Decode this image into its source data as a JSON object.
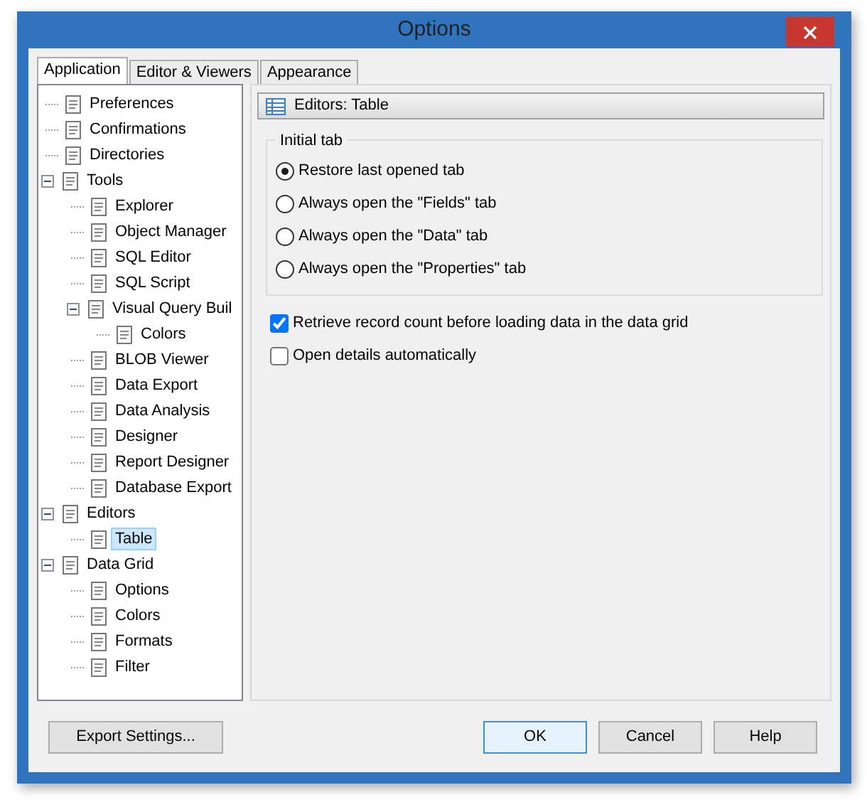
{
  "window": {
    "title": "Options"
  },
  "tabs": [
    {
      "label": "Application",
      "selected": true
    },
    {
      "label": "Editor & Viewers",
      "selected": false
    },
    {
      "label": "Appearance",
      "selected": false
    }
  ],
  "tree": [
    {
      "label": "Preferences",
      "selected": false
    },
    {
      "label": "Confirmations",
      "selected": false
    },
    {
      "label": "Directories",
      "selected": false
    },
    {
      "label": "Tools",
      "selected": false,
      "expanded": true,
      "children": [
        {
          "label": "Explorer",
          "selected": false
        },
        {
          "label": "Object Manager",
          "selected": false
        },
        {
          "label": "SQL Editor",
          "selected": false
        },
        {
          "label": "SQL Script",
          "selected": false
        },
        {
          "label": "Visual Query Buil",
          "selected": false,
          "expanded": true,
          "children": [
            {
              "label": "Colors",
              "selected": false
            }
          ]
        },
        {
          "label": "BLOB Viewer",
          "selected": false
        },
        {
          "label": "Data Export",
          "selected": false
        },
        {
          "label": "Data Analysis",
          "selected": false
        },
        {
          "label": "Designer",
          "selected": false
        },
        {
          "label": "Report Designer",
          "selected": false
        },
        {
          "label": "Database Export",
          "selected": false
        }
      ]
    },
    {
      "label": "Editors",
      "selected": false,
      "expanded": true,
      "children": [
        {
          "label": "Table",
          "selected": true
        }
      ]
    },
    {
      "label": "Data Grid",
      "selected": false,
      "expanded": true,
      "children": [
        {
          "label": "Options",
          "selected": false
        },
        {
          "label": "Colors",
          "selected": false
        },
        {
          "label": "Formats",
          "selected": false
        },
        {
          "label": "Filter",
          "selected": false
        }
      ]
    }
  ],
  "panel": {
    "title": "Editors: Table",
    "group": {
      "title": "Initial tab",
      "options": [
        {
          "label": "Restore last opened tab",
          "selected": true
        },
        {
          "label": "Always open the \"Fields\" tab",
          "selected": false
        },
        {
          "label": "Always open the \"Data\" tab",
          "selected": false
        },
        {
          "label": "Always open the \"Properties\" tab",
          "selected": false
        }
      ]
    },
    "checkboxes": [
      {
        "label": "Retrieve record count before loading data in the data grid",
        "checked": true
      },
      {
        "label": "Open details automatically",
        "checked": false
      }
    ]
  },
  "buttons_left": [
    {
      "label": "Export Settings...",
      "focused": false
    }
  ],
  "buttons_right": [
    {
      "label": "OK",
      "focused": true
    },
    {
      "label": "Cancel",
      "focused": false
    },
    {
      "label": "Help",
      "focused": false
    }
  ]
}
